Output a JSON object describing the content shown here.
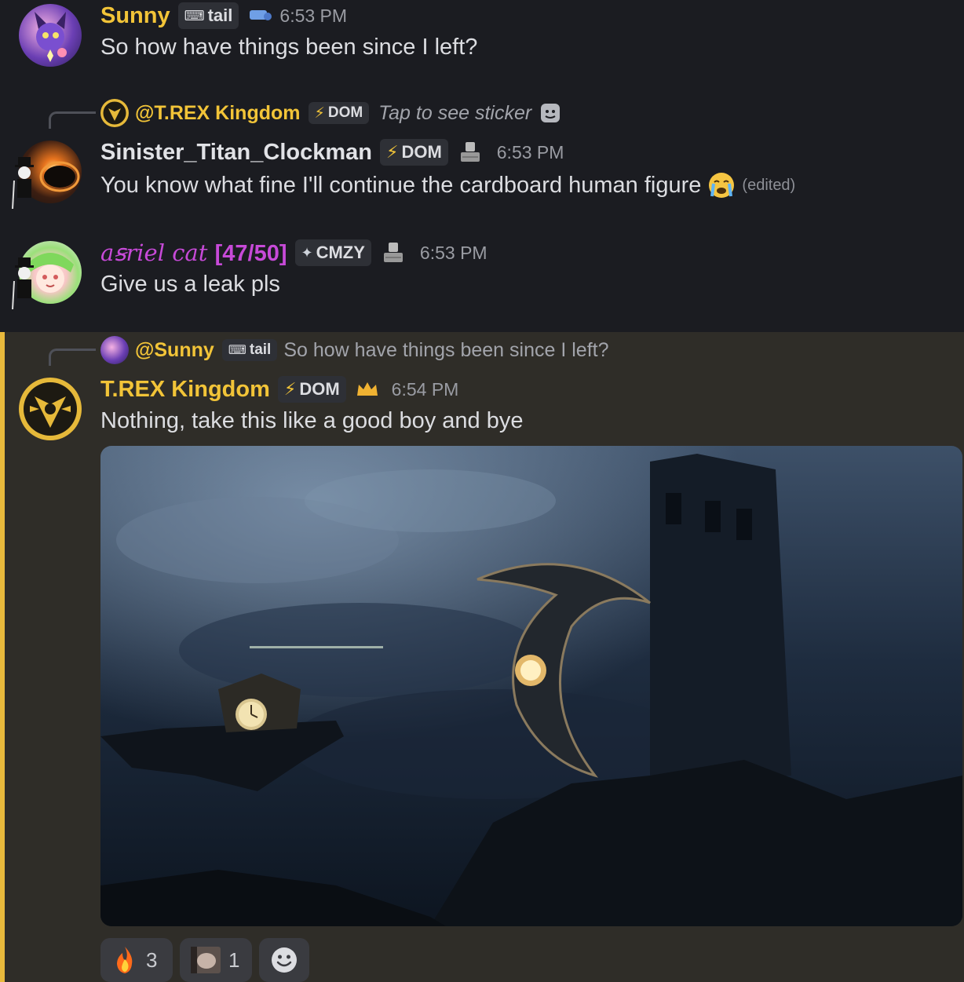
{
  "messages": {
    "sunny": {
      "username": "Sunny",
      "username_color": "#f2c438",
      "tag": "tail",
      "time": "6:53 PM",
      "text": "So how have things been since I left?"
    },
    "clockman": {
      "reply_mention": "@T.REX Kingdom",
      "reply_tag": "DOM",
      "reply_preview": "Tap to see sticker",
      "username": "Sinister_Titan_Clockman",
      "username_color": "#e1e2e6",
      "tag": "DOM",
      "time": "6:53 PM",
      "text": "You know what fine I'll continue the cardboard human figure",
      "edited": "(edited)"
    },
    "asriel": {
      "username": "a𝔰𝔯𝔦𝔢𝔩 𝔠𝔞𝔱 [47/50]",
      "username_prefix": "aꞩriel cat",
      "username_count": "[47/50]",
      "username_color": "#c74ad8",
      "tag": "CMZY",
      "time": "6:53 PM",
      "text": "Give us a leak pls"
    },
    "trex": {
      "reply_mention": "@Sunny",
      "reply_tag": "tail",
      "reply_preview": "So how have things been since I left?",
      "username": "T.REX Kingdom",
      "username_color": "#f2c438",
      "tag": "DOM",
      "time": "6:54 PM",
      "text": "Nothing, take this like a good boy and bye"
    }
  },
  "reactions": [
    {
      "emoji": "fire-emoji",
      "count": "3"
    },
    {
      "emoji": "custom-emoji",
      "count": "1"
    },
    {
      "emoji": "add-reaction-icon",
      "count": ""
    }
  ],
  "colors": {
    "background": "#1b1c21",
    "highlight": "#2f2d28",
    "highlight_bar": "#e8b93c",
    "mention": "#f2c438",
    "muted": "#9a9ca3"
  }
}
